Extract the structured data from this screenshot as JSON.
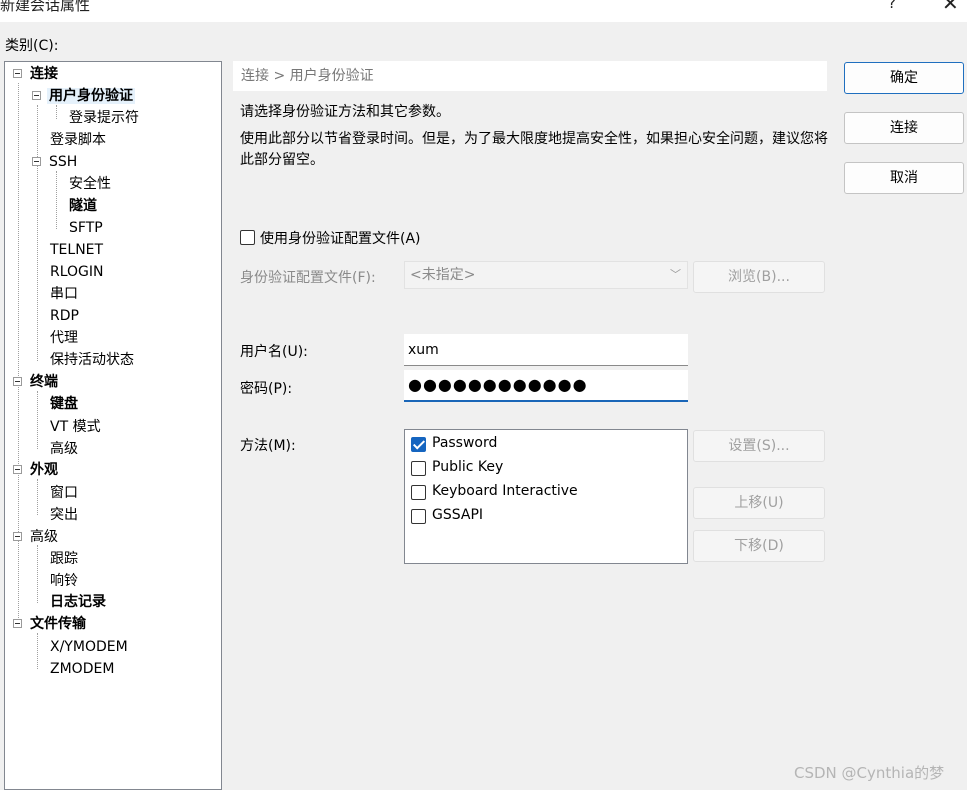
{
  "window": {
    "title": "新建会话属性",
    "help": "?",
    "close": "✕"
  },
  "category_label": "类别(C):",
  "tree": {
    "items": [
      {
        "label": "连接",
        "bold": true
      },
      {
        "label": "用户身份验证",
        "bold": true
      },
      {
        "label": "登录提示符"
      },
      {
        "label": "登录脚本"
      },
      {
        "label": "SSH"
      },
      {
        "label": "安全性"
      },
      {
        "label": "隧道",
        "bold": true
      },
      {
        "label": "SFTP"
      },
      {
        "label": "TELNET"
      },
      {
        "label": "RLOGIN"
      },
      {
        "label": "串口"
      },
      {
        "label": "RDP"
      },
      {
        "label": "代理"
      },
      {
        "label": "保持活动状态"
      },
      {
        "label": "终端",
        "bold": true
      },
      {
        "label": "键盘",
        "bold": true
      },
      {
        "label": "VT 模式"
      },
      {
        "label": "高级"
      },
      {
        "label": "外观",
        "bold": true
      },
      {
        "label": "窗口"
      },
      {
        "label": "突出"
      },
      {
        "label": "高级"
      },
      {
        "label": "跟踪"
      },
      {
        "label": "响铃"
      },
      {
        "label": "日志记录",
        "bold": true
      },
      {
        "label": "文件传输",
        "bold": true
      },
      {
        "label": "X/YMODEM"
      },
      {
        "label": "ZMODEM"
      }
    ]
  },
  "panel": {
    "breadcrumb": "连接 > 用户身份验证",
    "desc1": "请选择身份验证方法和其它参数。",
    "desc2": "使用此部分以节省登录时间。但是，为了最大限度地提高安全性，如果担心安全问题，建议您将此部分留空。",
    "use_profile_label": "使用身份验证配置文件(A)",
    "profile_label": "身份验证配置文件(F):",
    "profile_value": "<未指定>",
    "browse_label": "浏览(B)...",
    "username_label": "用户名(U):",
    "username_value": "xum",
    "password_label": "密码(P):",
    "password_value": "●●●●●●●●●●●●",
    "method_label": "方法(M):",
    "methods": [
      {
        "label": "Password",
        "checked": true
      },
      {
        "label": "Public Key",
        "checked": false
      },
      {
        "label": "Keyboard Interactive",
        "checked": false
      },
      {
        "label": "GSSAPI",
        "checked": false
      }
    ],
    "settings_label": "设置(S)...",
    "move_up_label": "上移(U)",
    "move_down_label": "下移(D)"
  },
  "buttons": {
    "ok": "确定",
    "connect": "连接",
    "cancel": "取消"
  },
  "watermark": "CSDN @Cynthia的梦",
  "colors": {
    "accent": "#1565c0",
    "focus": "#1a66b8",
    "selection": "#e5f1fb"
  }
}
